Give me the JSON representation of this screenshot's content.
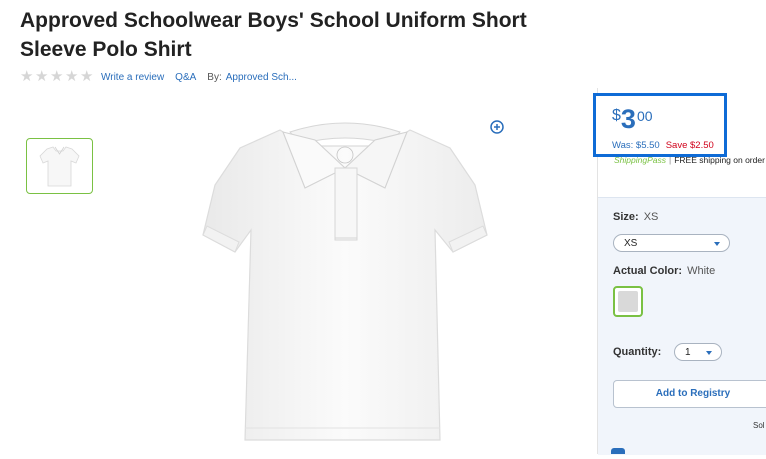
{
  "product": {
    "title": "Approved Schoolwear Boys' School Uniform Short Sleeve Polo Shirt"
  },
  "rating": {
    "stars_filled": 0,
    "stars_total": 5,
    "write_review_label": "Write a review",
    "qa_label": "Q&A",
    "by_label": "By:",
    "brand_link": "Approved Sch..."
  },
  "icons": {
    "zoom": "zoom-in-plus-icon",
    "star": "star-icon",
    "caret": "chevron-down-icon"
  },
  "price": {
    "currency": "$",
    "dollars": "3",
    "cents": "00",
    "was_label": "Was: $5.50",
    "save_label": "Save $2.50"
  },
  "shipping": {
    "pass_label": "ShippingPass",
    "separator": "|",
    "text": "FREE shipping on order"
  },
  "options": {
    "size_label": "Size:",
    "size_value": "XS",
    "size_select_value": "XS",
    "color_label": "Actual Color:",
    "color_value": "White",
    "quantity_label": "Quantity:",
    "quantity_value": "1"
  },
  "actions": {
    "add_to_registry": "Add to Registry"
  },
  "misc": {
    "sold_text": "Sol"
  },
  "colors": {
    "link_blue": "#2a6ebb",
    "save_red": "#d0021b",
    "highlight_border": "#0e6bd6",
    "accent_green": "#7ac143",
    "options_bg": "#f1f5fb"
  }
}
